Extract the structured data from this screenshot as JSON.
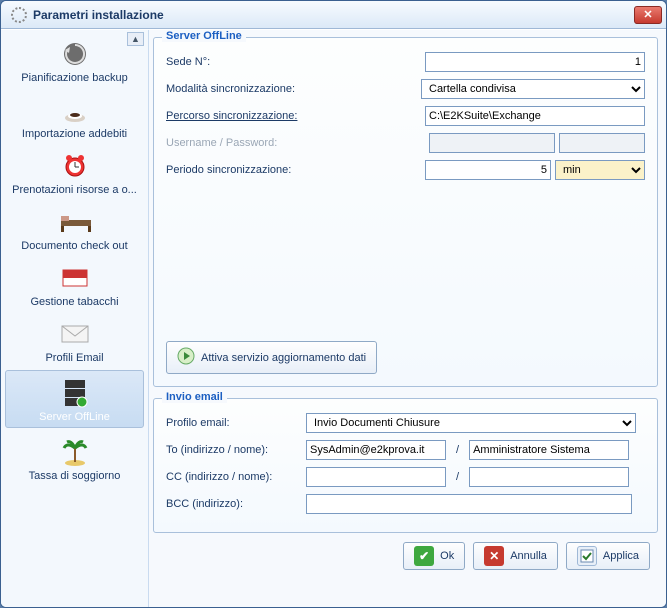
{
  "window": {
    "title": "Parametri installazione"
  },
  "sidebar": {
    "items": [
      {
        "label": "Pianificazione backup",
        "icon": "refresh-icon"
      },
      {
        "label": "Importazione addebiti",
        "icon": "coffee-icon"
      },
      {
        "label": "Prenotazioni risorse a o...",
        "icon": "alarm-icon"
      },
      {
        "label": "Documento check out",
        "icon": "bed-icon"
      },
      {
        "label": "Gestione tabacchi",
        "icon": "cigarette-icon"
      },
      {
        "label": "Profili Email",
        "icon": "envelope-icon"
      },
      {
        "label": "Server OffLine",
        "icon": "server-icon"
      },
      {
        "label": "Tassa di soggiorno",
        "icon": "palm-icon"
      }
    ],
    "selected_index": 6
  },
  "server_offline": {
    "legend": "Server OffLine",
    "labels": {
      "sede": "Sede N°:",
      "mode": "Modalità sincronizzazione:",
      "path": "Percorso sincronizzazione:",
      "cred": "Username / Password:",
      "period": "Periodo sincronizzazione:"
    },
    "values": {
      "sede": "1",
      "mode_options": [
        "Cartella condivisa"
      ],
      "mode_selected": "Cartella condivisa",
      "path": "C:\\E2KSuite\\Exchange",
      "username": "",
      "password": "",
      "period_value": "5",
      "period_unit_options": [
        "min"
      ],
      "period_unit_selected": "min"
    },
    "activate_button": "Attiva servizio aggiornamento dati"
  },
  "email": {
    "legend": "Invio email",
    "labels": {
      "profile": "Profilo email:",
      "to": "To (indirizzo / nome):",
      "cc": "CC (indirizzo / nome):",
      "bcc": "BCC (indirizzo):"
    },
    "values": {
      "profile_options": [
        "Invio Documenti Chiusure"
      ],
      "profile_selected": "Invio Documenti Chiusure",
      "to_addr": "SysAdmin@e2kprova.it",
      "to_name": "Amministratore Sistema",
      "cc_addr": "",
      "cc_name": "",
      "bcc": ""
    }
  },
  "buttons": {
    "ok": "Ok",
    "cancel": "Annulla",
    "apply": "Applica"
  }
}
